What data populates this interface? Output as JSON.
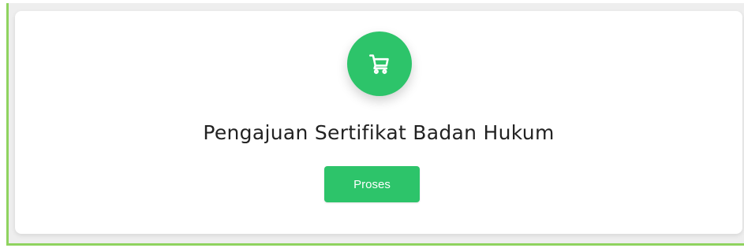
{
  "card": {
    "icon": "shopping-cart-icon",
    "title": "Pengajuan Sertifikat Badan Hukum",
    "button_label": "Proses"
  },
  "colors": {
    "accent": "#2dc46a",
    "frame_border": "#8fd35f",
    "title_text": "#222222",
    "button_text": "#ffffff"
  }
}
